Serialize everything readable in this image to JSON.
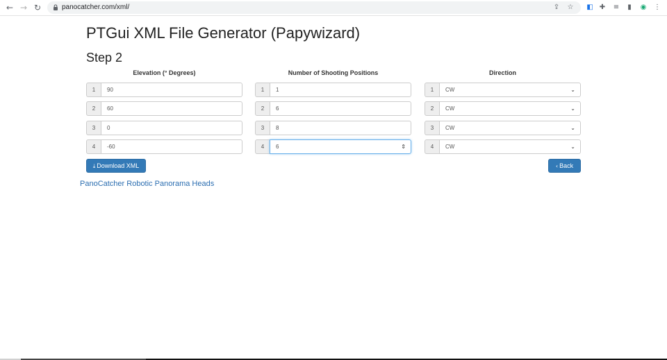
{
  "browser": {
    "url": "panocatcher.com/xml/"
  },
  "page": {
    "title": "PTGui XML File Generator (Papywizard)",
    "step": "Step 2"
  },
  "columns": {
    "elevation": {
      "header": "Elevation (° Degrees)",
      "rows": [
        {
          "index": "1",
          "value": "90"
        },
        {
          "index": "2",
          "value": "60"
        },
        {
          "index": "3",
          "value": "0"
        },
        {
          "index": "4",
          "value": "-60"
        }
      ]
    },
    "positions": {
      "header": "Number of Shooting Positions",
      "rows": [
        {
          "index": "1",
          "value": "1"
        },
        {
          "index": "2",
          "value": "6"
        },
        {
          "index": "3",
          "value": "8"
        },
        {
          "index": "4",
          "value": "6"
        }
      ]
    },
    "direction": {
      "header": "Direction",
      "rows": [
        {
          "index": "1",
          "value": "CW"
        },
        {
          "index": "2",
          "value": "CW"
        },
        {
          "index": "3",
          "value": "CW"
        },
        {
          "index": "4",
          "value": "CW"
        }
      ]
    }
  },
  "buttons": {
    "download": "Download XML",
    "back": "Back"
  },
  "footer": {
    "link": "PanoCatcher Robotic Panorama Heads"
  },
  "colors": {
    "primary": "#337ab7",
    "link": "#2a6db0",
    "focus": "#66afe9"
  }
}
